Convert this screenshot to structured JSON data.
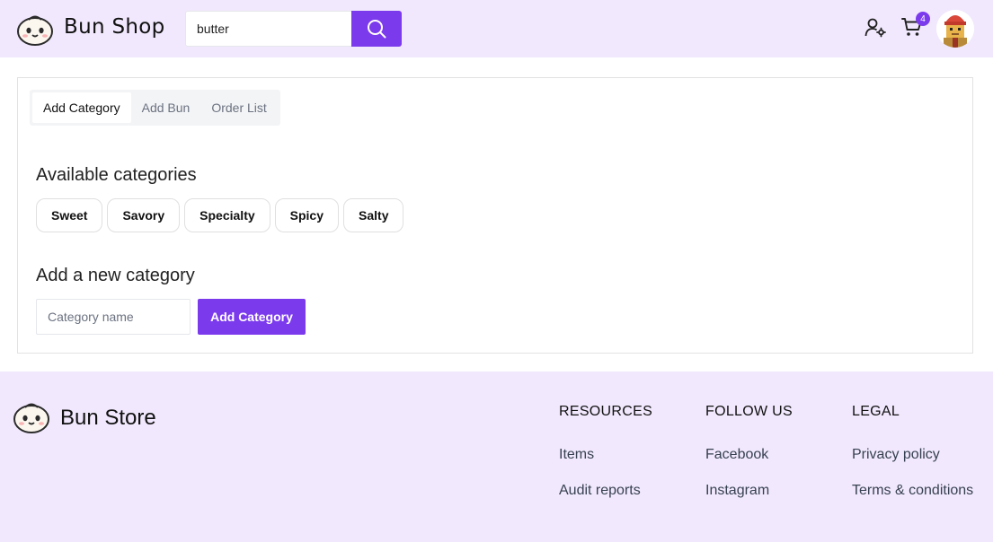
{
  "header": {
    "brand": "Bun Shop",
    "search": {
      "value": "butter",
      "placeholder": ""
    },
    "icons": {
      "search": "search-icon",
      "user_settings": "user-settings-icon",
      "cart": "cart-icon",
      "avatar": "avatar-image"
    },
    "cart_count": "4"
  },
  "tabs": [
    {
      "label": "Add Category",
      "active": true
    },
    {
      "label": "Add Bun",
      "active": false
    },
    {
      "label": "Order List",
      "active": false
    }
  ],
  "categories": {
    "title": "Available categories",
    "items": [
      "Sweet",
      "Savory",
      "Specialty",
      "Spicy",
      "Salty"
    ]
  },
  "new_category": {
    "title": "Add a new category",
    "placeholder": "Category name",
    "button_label": "Add Category"
  },
  "footer": {
    "brand": "Bun Store",
    "columns": [
      {
        "heading": "RESOURCES",
        "links": [
          "Items",
          "Audit reports"
        ]
      },
      {
        "heading": "FOLLOW US",
        "links": [
          "Facebook",
          "Instagram"
        ]
      },
      {
        "heading": "LEGAL",
        "links": [
          "Privacy policy",
          "Terms & conditions"
        ]
      }
    ]
  },
  "colors": {
    "accent": "#7c3aed",
    "header_bg": "#f1e8fd",
    "footer_bg": "#f1e8fd"
  }
}
